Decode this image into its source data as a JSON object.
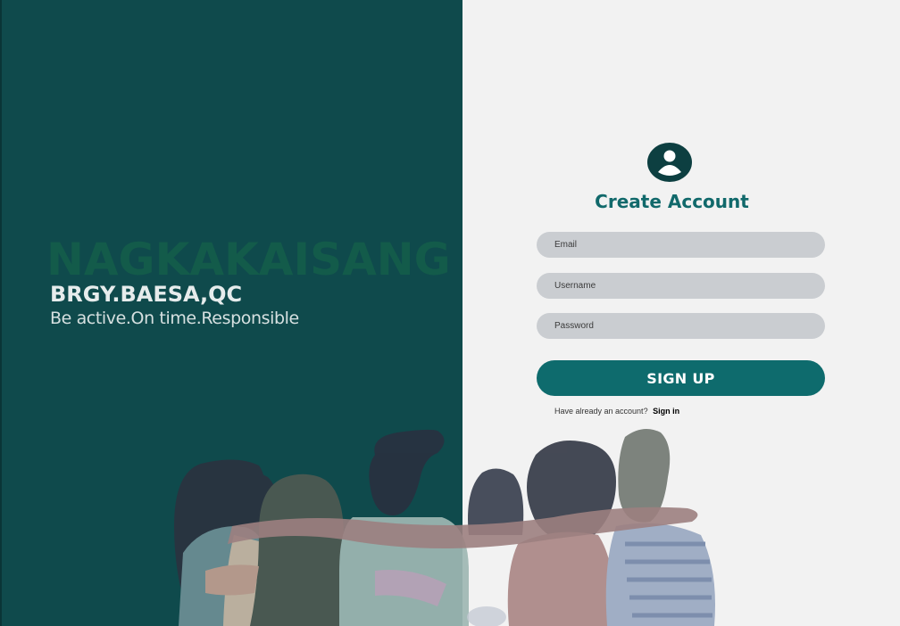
{
  "brand": {
    "title": "NAGKAKAISANG",
    "subtitle": "BRGY.BAESA,QC",
    "tagline": "Be active.On time.Responsible"
  },
  "form": {
    "title": "Create Account",
    "email_placeholder": "Email",
    "username_placeholder": "Username",
    "password_placeholder": "Password",
    "signup_label": "SIGN UP",
    "have_account_text": "Have already an account?",
    "signin_label": "Sign in"
  },
  "colors": {
    "left_panel": "#0f4a4c",
    "right_panel": "#f2f2f2",
    "accent": "#0e6b6d",
    "brand_title": "#135b4a",
    "field_bg": "#cacdd1"
  },
  "icons": {
    "avatar": "user-circle-icon"
  },
  "illustration": "group-of-friends-hugging-illustration"
}
